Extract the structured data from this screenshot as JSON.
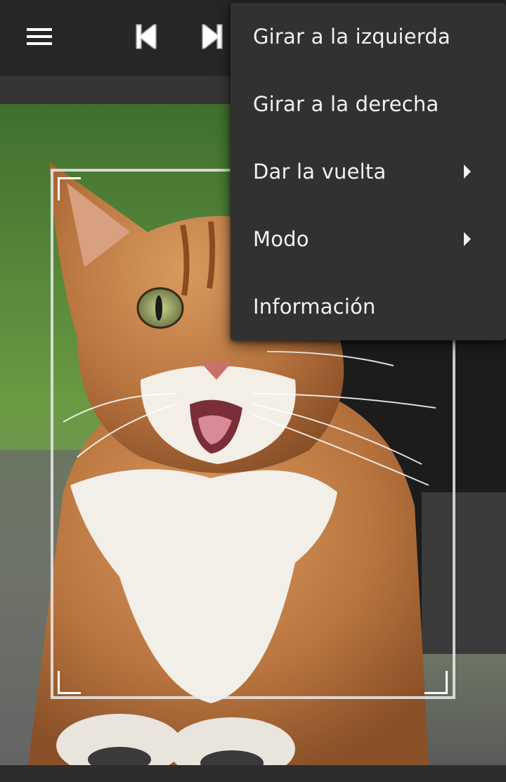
{
  "toolbar": {
    "menu_icon": "hamburger-menu-icon",
    "prev_icon": "skip-previous-icon",
    "next_icon": "skip-next-icon"
  },
  "image": {
    "subject": "cat-photo"
  },
  "popup_menu": {
    "items": [
      {
        "label": "Girar a la izquierda",
        "has_submenu": false
      },
      {
        "label": "Girar a la derecha",
        "has_submenu": false
      },
      {
        "label": "Dar la vuelta",
        "has_submenu": true
      },
      {
        "label": "Modo",
        "has_submenu": true
      },
      {
        "label": "Información",
        "has_submenu": false
      }
    ]
  },
  "colors": {
    "toolbar_bg": "#262626",
    "menu_bg": "#313131",
    "menu_text": "#f1f1f1"
  }
}
